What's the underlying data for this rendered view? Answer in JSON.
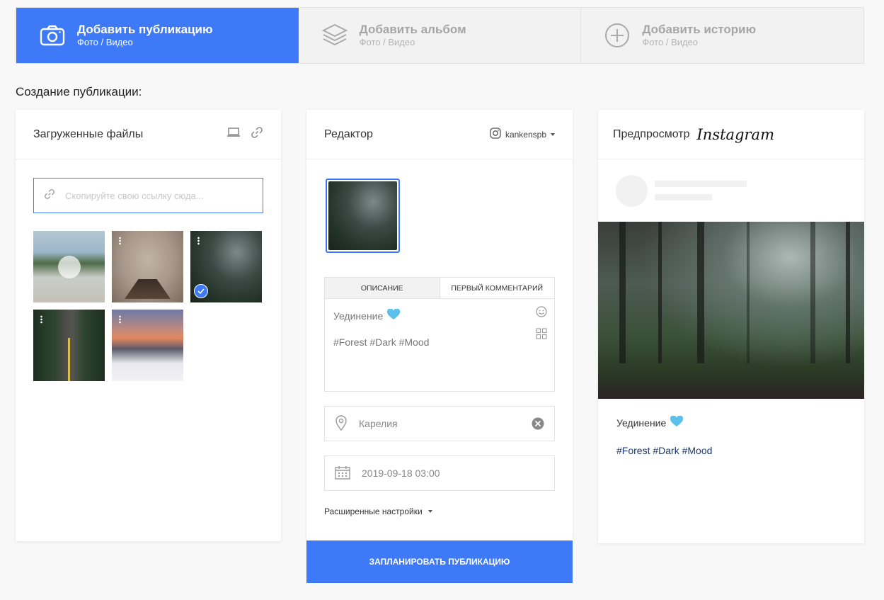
{
  "tabs": [
    {
      "title": "Добавить публикацию",
      "subtitle": "Фото / Видео",
      "icon": "camera-icon",
      "active": true
    },
    {
      "title": "Добавить альбом",
      "subtitle": "Фото / Видео",
      "icon": "layers-icon",
      "active": false
    },
    {
      "title": "Добавить историю",
      "subtitle": "Фото / Видео",
      "icon": "plus-circle-icon",
      "active": false
    }
  ],
  "section_title": "Создание публикации:",
  "files": {
    "title": "Загруженные файлы",
    "link_placeholder": "Скопируйте свою ссылку сюда...",
    "thumbnails": [
      "beach",
      "pier",
      "forest (selected)",
      "road",
      "mountains"
    ]
  },
  "editor": {
    "title": "Редактор",
    "account": "kankenspb",
    "tabs": [
      "Описание",
      "Первый комментарий"
    ],
    "description_line1": "Уединение",
    "description_tags": "#Forest #Dark #Mood",
    "location": "Карелия",
    "datetime": "2019-09-18 03:00",
    "advanced": "Расширенные настройки",
    "submit": "Запланировать публикацию"
  },
  "preview": {
    "title": "Предпросмотр",
    "brand": "Instagram",
    "caption": "Уединение",
    "tags": "#Forest #Dark #Mood"
  },
  "colors": {
    "accent": "#3e7af7",
    "heart": "#5bc0eb"
  }
}
